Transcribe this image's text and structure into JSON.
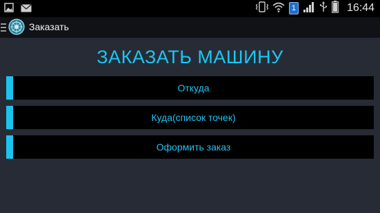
{
  "status_bar": {
    "time": "16:44",
    "notification_badge": "1",
    "left_icons": [
      "image-icon",
      "mail-icon"
    ],
    "right_icons": [
      "vibrate-icon",
      "wifi-icon",
      "notification-badge",
      "signal-icon",
      "usb-icon",
      "battery-icon"
    ]
  },
  "action_bar": {
    "title": "Заказать"
  },
  "main": {
    "heading": "ЗАКАЗАТЬ МАШИНУ",
    "buttons": [
      {
        "label": "Откуда"
      },
      {
        "label": "Куда(список точек)"
      },
      {
        "label": "Оформить заказ"
      }
    ]
  },
  "colors": {
    "accent": "#1ac4f0",
    "background": "#272b35",
    "button_bg": "#000000",
    "action_bar_bg": "#101216"
  }
}
